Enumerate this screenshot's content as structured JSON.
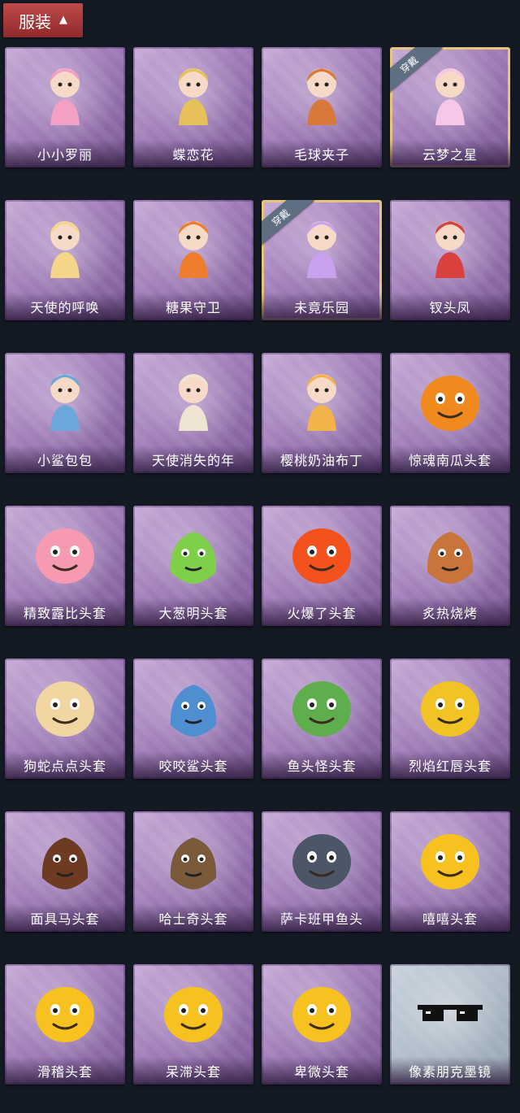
{
  "header": {
    "title": "服装",
    "expand_icon": "chevron-up-icon"
  },
  "items": [
    {
      "name": "小小罗丽",
      "equipped": false,
      "badge": "",
      "icon": "girl-doll",
      "color": "#f3a0c4",
      "style": "purple"
    },
    {
      "name": "蝶恋花",
      "equipped": false,
      "badge": "",
      "icon": "bell-ornament",
      "color": "#e6c15a",
      "style": "purple"
    },
    {
      "name": "毛球夹子",
      "equipped": false,
      "badge": "",
      "icon": "raccoon-drummer",
      "color": "#d9783b",
      "style": "purple"
    },
    {
      "name": "云梦之星",
      "equipped": true,
      "badge": "穿戴",
      "icon": "unicorn",
      "color": "#f6c7e6",
      "style": "purple"
    },
    {
      "name": "天使的呼唤",
      "equipped": false,
      "badge": "",
      "icon": "angel-doll",
      "color": "#f5d58a",
      "style": "purple"
    },
    {
      "name": "糖果守卫",
      "equipped": false,
      "badge": "",
      "icon": "pumpkin-scarecrow",
      "color": "#ee7d2e",
      "style": "purple"
    },
    {
      "name": "未竟乐园",
      "equipped": true,
      "badge": "穿戴",
      "icon": "bunny-girl",
      "color": "#c9a2ef",
      "style": "purple"
    },
    {
      "name": "钗头凤",
      "equipped": false,
      "badge": "",
      "icon": "opera-doll",
      "color": "#d9413e",
      "style": "purple"
    },
    {
      "name": "小鲨包包",
      "equipped": false,
      "badge": "",
      "icon": "shark-bag",
      "color": "#6ca7dc",
      "style": "purple"
    },
    {
      "name": "天使消失的年",
      "equipped": false,
      "badge": "",
      "icon": "veiled-girl",
      "color": "#efe4d2",
      "style": "purple"
    },
    {
      "name": "樱桃奶油布丁",
      "equipped": false,
      "badge": "",
      "icon": "pudding",
      "color": "#f2b34a",
      "style": "purple"
    },
    {
      "name": "惊魂南瓜头套",
      "equipped": false,
      "badge": "",
      "icon": "pumpkin-head",
      "color": "#f08a1f",
      "style": "purple"
    },
    {
      "name": "精致露比头套",
      "equipped": false,
      "badge": "",
      "icon": "pink-beaver",
      "color": "#f59ab0",
      "style": "purple"
    },
    {
      "name": "大葱明头套",
      "equipped": false,
      "badge": "",
      "icon": "green-onion",
      "color": "#7fcf4a",
      "style": "purple"
    },
    {
      "name": "火爆了头套",
      "equipped": false,
      "badge": "",
      "icon": "fire-face",
      "color": "#f4521d",
      "style": "purple"
    },
    {
      "name": "炙热烧烤",
      "equipped": false,
      "badge": "",
      "icon": "meat-face",
      "color": "#c8743a",
      "style": "purple"
    },
    {
      "name": "狗蛇点点头套",
      "equipped": false,
      "badge": "",
      "icon": "snake-face",
      "color": "#f1d6a2",
      "style": "purple"
    },
    {
      "name": "咬咬鲨头套",
      "equipped": false,
      "badge": "",
      "icon": "shark-head",
      "color": "#4f8fd1",
      "style": "purple"
    },
    {
      "name": "鱼头怪头套",
      "equipped": false,
      "badge": "",
      "icon": "fish-mask",
      "color": "#5fae4e",
      "style": "purple"
    },
    {
      "name": "烈焰红唇头套",
      "equipped": false,
      "badge": "",
      "icon": "pikachu-mask",
      "color": "#f2c324",
      "style": "purple"
    },
    {
      "name": "面具马头套",
      "equipped": false,
      "badge": "",
      "icon": "horse-mask",
      "color": "#6d3a22",
      "style": "purple"
    },
    {
      "name": "哈士奇头套",
      "equipped": false,
      "badge": "",
      "icon": "husky-mask",
      "color": "#7b5a3b",
      "style": "purple"
    },
    {
      "name": "萨卡班甲鱼头",
      "equipped": false,
      "badge": "",
      "icon": "fish-head",
      "color": "#4c5666",
      "style": "purple"
    },
    {
      "name": "嘻嘻头套",
      "equipped": false,
      "badge": "",
      "icon": "grin-emoji",
      "color": "#f7c21f",
      "style": "purple"
    },
    {
      "name": "滑稽头套",
      "equipped": false,
      "badge": "",
      "icon": "smirk-emoji",
      "color": "#f7c21f",
      "style": "purple"
    },
    {
      "name": "呆滞头套",
      "equipped": false,
      "badge": "",
      "icon": "stare-emoji",
      "color": "#f7c21f",
      "style": "purple"
    },
    {
      "name": "卑微头套",
      "equipped": false,
      "badge": "",
      "icon": "humble-emoji",
      "color": "#f7c21f",
      "style": "purple"
    },
    {
      "name": "像素朋克墨镜",
      "equipped": false,
      "badge": "",
      "icon": "pixel-sunglasses",
      "color": "#111111",
      "style": "gray"
    }
  ]
}
